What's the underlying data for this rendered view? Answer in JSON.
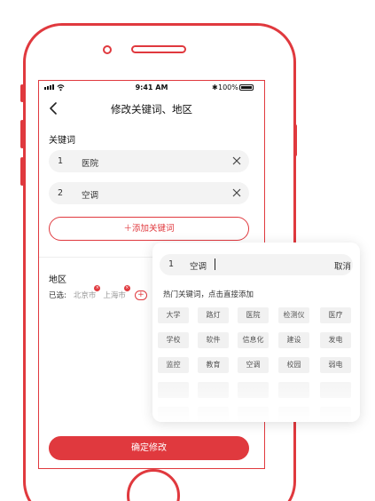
{
  "status_bar": {
    "time": "9:41 AM",
    "battery": "100%",
    "bluetooth": "✱"
  },
  "nav": {
    "title": "修改关键词、地区"
  },
  "keywords": {
    "label": "关键词",
    "items": [
      {
        "num": "1",
        "text": "医院"
      },
      {
        "num": "2",
        "text": "空调"
      }
    ],
    "add_label": "添加关键词"
  },
  "region": {
    "label": "地区",
    "selected_prefix": "已选:",
    "cities": [
      "北京市",
      "上海市"
    ],
    "add_symbol": "+",
    "remove_symbol": "×"
  },
  "confirm_label": "确定修改",
  "popup": {
    "input_num": "1",
    "input_value": "空调",
    "cancel_label": "取消",
    "hot_title": "热门关键词，点击直接添加",
    "tags": [
      "大学",
      "路灯",
      "医院",
      "检测仪",
      "医疗",
      "学校",
      "软件",
      "信息化",
      "建设",
      "发电",
      "监控",
      "教育",
      "空调",
      "校园",
      "弱电"
    ]
  },
  "colors": {
    "accent": "#e0393e",
    "field_bg": "#f3f3f3",
    "tag_bg": "#f1f1f1"
  }
}
